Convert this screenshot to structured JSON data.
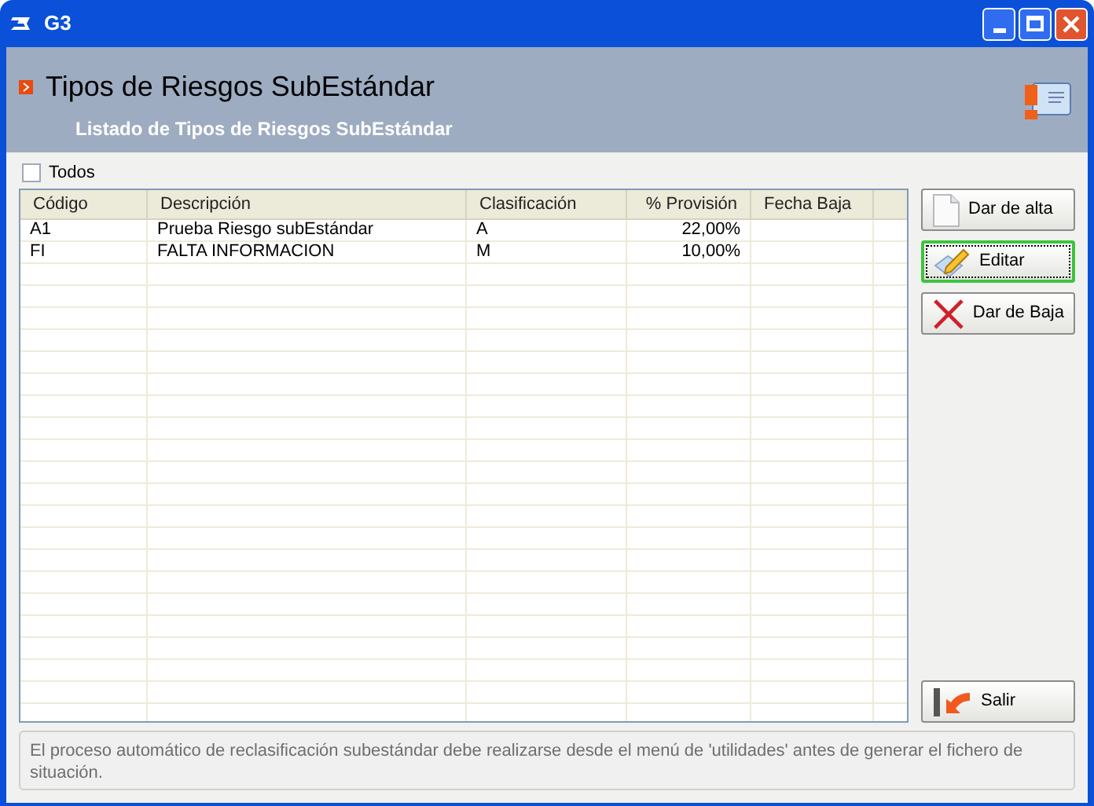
{
  "window": {
    "title": "G3"
  },
  "header": {
    "title": "Tipos de Riesgos SubEstándar",
    "subtitle": "Listado de Tipos de Riesgos SubEstándar"
  },
  "todos": {
    "label": "Todos",
    "checked": false
  },
  "table": {
    "columns": [
      {
        "label": "Código",
        "kind": "text"
      },
      {
        "label": "Descripción",
        "kind": "text"
      },
      {
        "label": "Clasificación",
        "kind": "text"
      },
      {
        "label": "% Provisión",
        "kind": "number"
      },
      {
        "label": "Fecha Baja",
        "kind": "text"
      }
    ],
    "rows": [
      [
        "A1",
        "Prueba Riesgo subEstándar",
        "A",
        "22,00%",
        ""
      ],
      [
        "FI",
        "FALTA INFORMACION",
        "M",
        "10,00%",
        ""
      ]
    ]
  },
  "buttons": [
    {
      "label": "Dar de alta",
      "kind": "new",
      "focused": false
    },
    {
      "label": "Editar",
      "kind": "edit",
      "focused": true
    },
    {
      "label": "Dar de Baja",
      "kind": "delete",
      "focused": false
    }
  ],
  "exit_button": {
    "label": "Salir",
    "kind": "exit",
    "focused": false
  },
  "message": "El proceso automático de reclasificación subestándar debe realizarse desde el menú de 'utilidades' antes de generar el fichero de situación."
}
